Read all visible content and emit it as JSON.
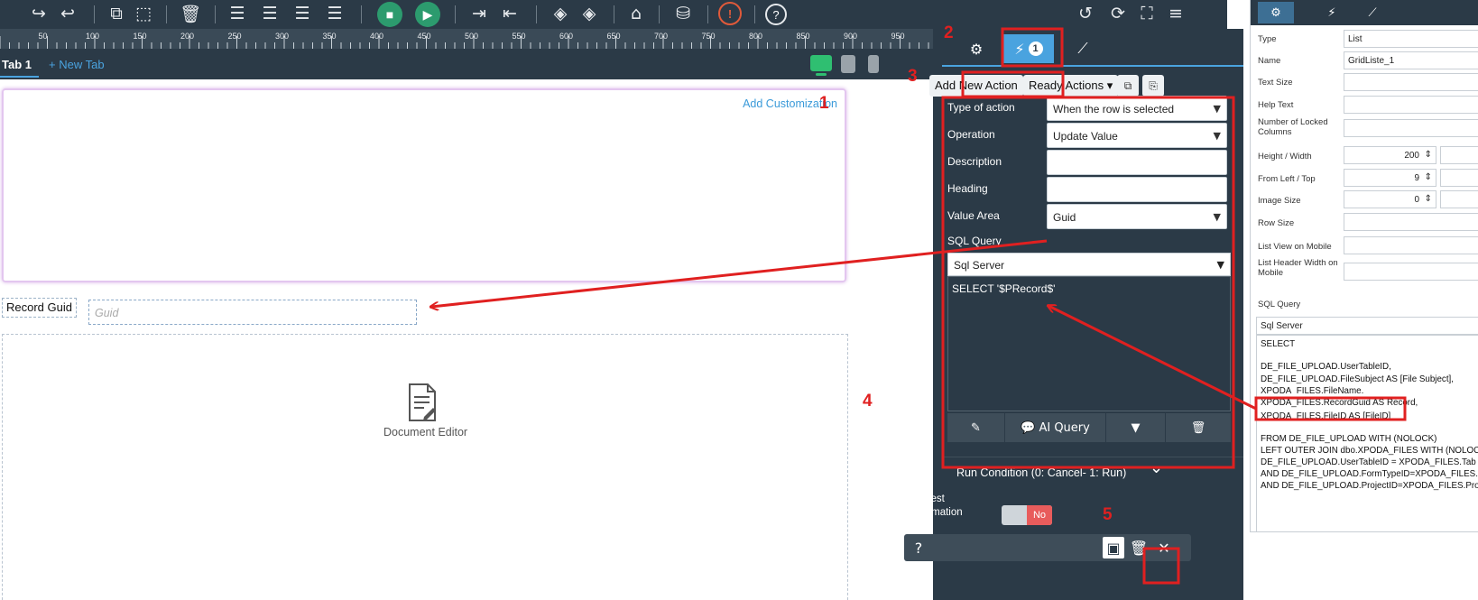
{
  "toolbar": {
    "icons": [
      "redo-icon",
      "undo-icon",
      "copy-icon",
      "paste-icon",
      "delete-icon",
      "align-left-icon",
      "align-center-icon",
      "align-right-icon",
      "align-justify-icon",
      "save-icon",
      "run-icon",
      "move-right-icon",
      "move-left-icon",
      "layers-up-icon",
      "layers-down-icon",
      "eraser-icon",
      "database-icon",
      "info-icon",
      "help-icon",
      "history-icon",
      "refresh-icon",
      "fullscreen-icon",
      "menu-icon"
    ]
  },
  "ruler": {
    "marks": [
      "50",
      "100",
      "150",
      "200",
      "250",
      "300",
      "350",
      "400",
      "450",
      "500",
      "550",
      "600",
      "650",
      "700",
      "750",
      "800",
      "850",
      "900",
      "950"
    ]
  },
  "tabs": {
    "tab1": "Tab 1",
    "new_tab": "+ New Tab"
  },
  "canvas": {
    "add_customization": "Add Customization",
    "record_guid_label": "Record Guid",
    "record_guid_placeholder": "Guid",
    "document_editor": "Document Editor"
  },
  "annotations": {
    "n1": "1",
    "n2": "2",
    "n3": "3",
    "n4": "4",
    "n5": "5"
  },
  "panel": {
    "actions_badge": "1",
    "add_new_action": "Add New Action",
    "ready_actions": "Ready Actions",
    "fields": {
      "type_of_action": {
        "label": "Type of action",
        "value": "When the row is selected"
      },
      "operation": {
        "label": "Operation",
        "value": "Update Value"
      },
      "description": {
        "label": "Description",
        "value": ""
      },
      "heading": {
        "label": "Heading",
        "value": ""
      },
      "value_area": {
        "label": "Value Area",
        "value": "Guid"
      }
    },
    "sql_query_label": "SQL Query",
    "sql_engine": "Sql Server",
    "sql_text": "SELECT '$PRecord$'",
    "ai_query": "AI Query",
    "run_condition": "Run Condition (0: Cancel- 1: Run)",
    "request_confirmation": "Request confirmation",
    "toggle_value": "No",
    "help_mark": "?"
  },
  "inset": {
    "fields": [
      {
        "label": "Type",
        "value": "List"
      },
      {
        "label": "Name",
        "value": "GridListe_1"
      },
      {
        "label": "Text Size",
        "value": ""
      },
      {
        "label": "Help Text",
        "value": ""
      },
      {
        "label": "Number of Locked Columns",
        "value": ""
      }
    ],
    "numeric": [
      {
        "label": "Height / Width",
        "value": "200"
      },
      {
        "label": "From Left / Top",
        "value": "9"
      },
      {
        "label": "Image Size",
        "value": "0"
      }
    ],
    "extra": [
      {
        "label": "Row Size"
      },
      {
        "label": "List View on Mobile"
      },
      {
        "label": "List Header Width on Mobile"
      }
    ],
    "sql_query_label": "SQL Query",
    "sql_engine": "Sql Server",
    "sql_lines": [
      "SELECT",
      "",
      "DE_FILE_UPLOAD.UserTableID,",
      "DE_FILE_UPLOAD.FileSubject AS [File Subject],",
      "XPODA_FILES.FileName,",
      "XPODA_FILES.RecordGuid AS Record,",
      "XPODA_FILES.FileID AS [FileID]",
      "",
      "FROM DE_FILE_UPLOAD WITH (NOLOCK)",
      "LEFT OUTER JOIN dbo.XPODA_FILES WITH (NOLOCK",
      "DE_FILE_UPLOAD.UserTableID = XPODA_FILES.Tab",
      "AND DE_FILE_UPLOAD.FormTypeID=XPODA_FILES.",
      "AND DE_FILE_UPLOAD.ProjectID=XPODA_FILES.Pro"
    ]
  },
  "colors": {
    "dark": "#2b3a47",
    "accent": "#4aa3df",
    "annotation": "#e02020",
    "toggle_no": "#e85c5c"
  }
}
